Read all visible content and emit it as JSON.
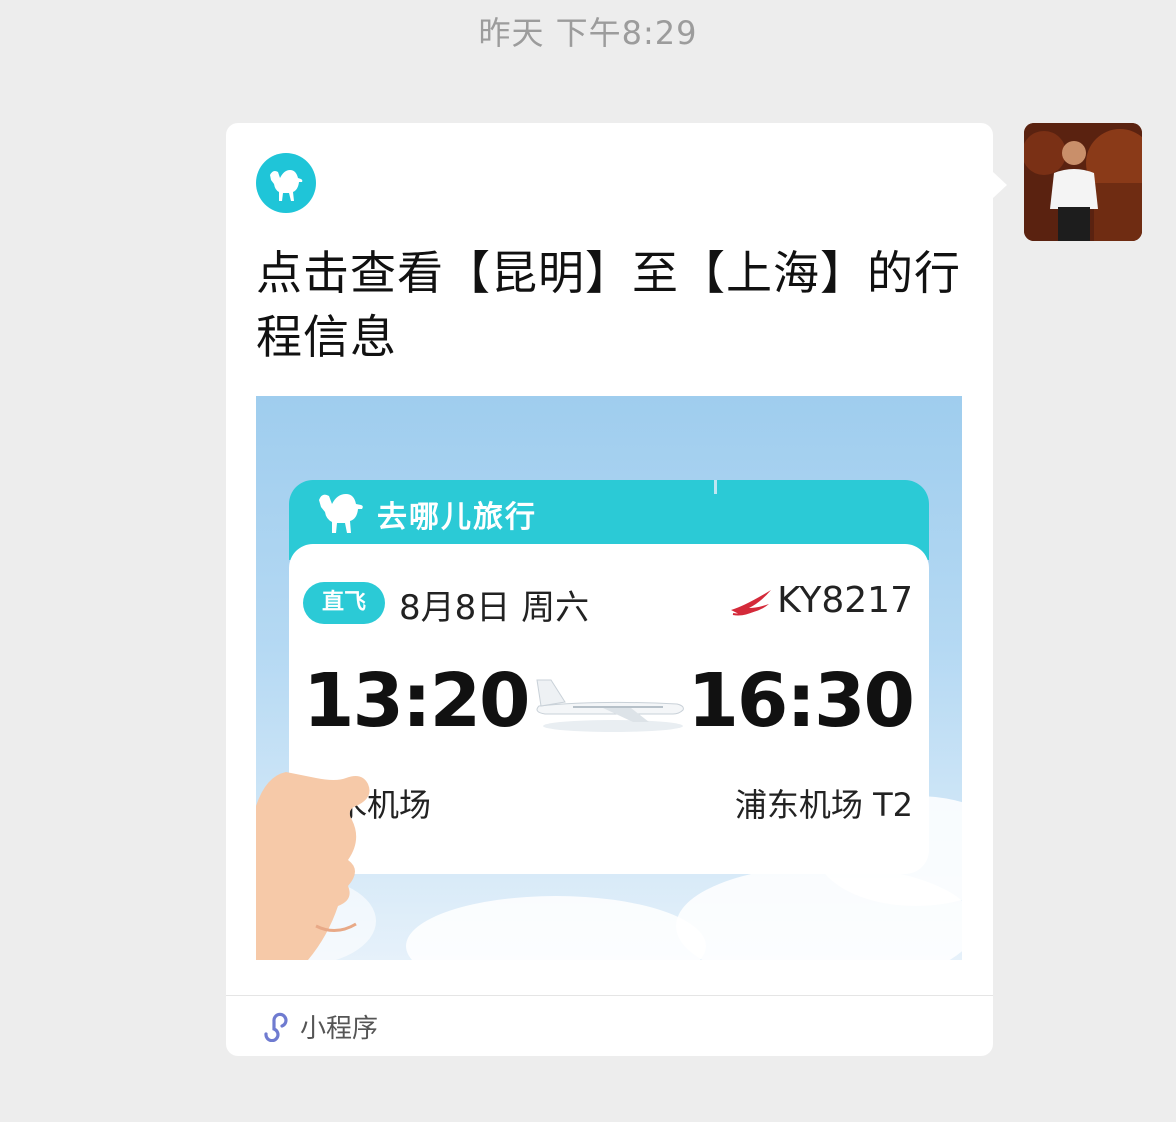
{
  "chat": {
    "timestamp": "昨天 下午8:29"
  },
  "message": {
    "title": "点击查看【昆明】至【上海】的行程信息",
    "preview": {
      "brand": "去哪儿旅行",
      "flight_type": "直飞",
      "date": "8月8日 周六",
      "flight_number": "KY8217",
      "departure_time": "13:20",
      "arrival_time": "16:30",
      "departure_airport": "长水机场",
      "arrival_airport": "浦东机场 T2"
    },
    "source_label": "小程序",
    "colors": {
      "brand_teal": "#2bcad6",
      "airline_red": "#d42a3a"
    }
  },
  "sender": {
    "avatar_icon": "user-avatar-photo"
  }
}
